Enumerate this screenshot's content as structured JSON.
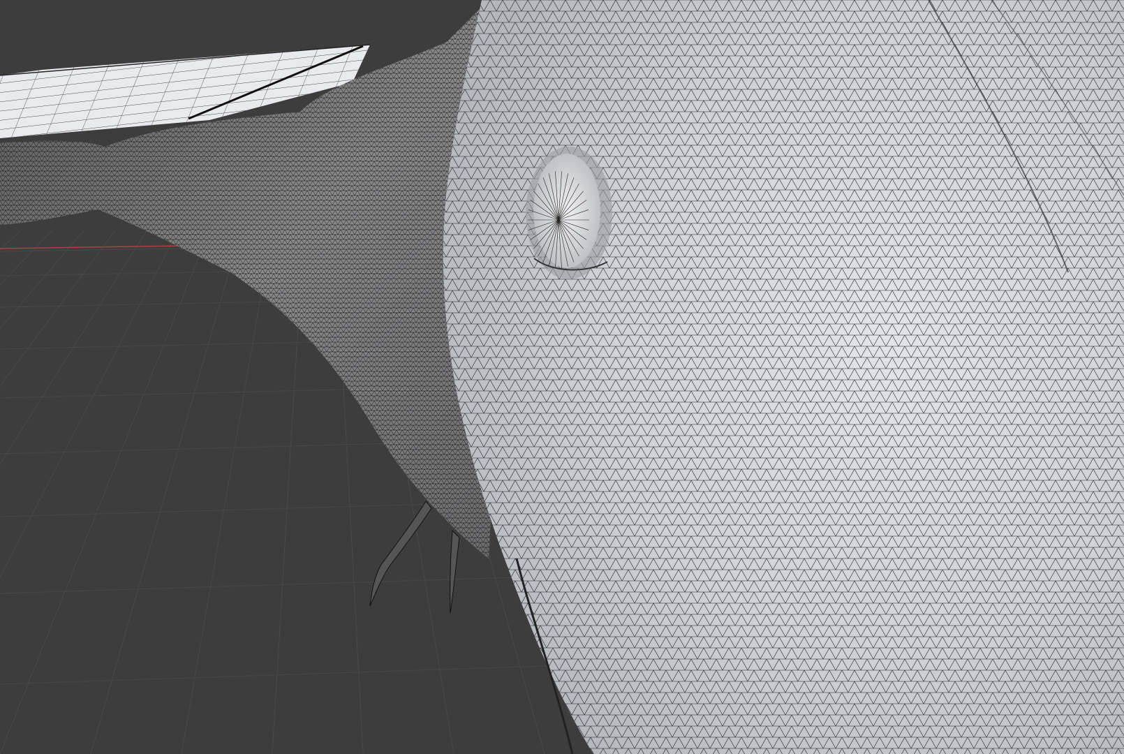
{
  "viewport": {
    "mode": "3d-viewport",
    "shading": "wireframe-overlay-on-solid",
    "background_color": "#3d3d3d",
    "grid_color": "#4a4a4a",
    "x_axis_color": "#b04040",
    "mesh_light_color": "#d8dbe2",
    "mesh_dark_color": "#2a2a2a",
    "wire_color": "#1a1a1a"
  },
  "objects": [
    {
      "name": "body-mesh",
      "icon": "mesh-icon"
    },
    {
      "name": "wing-mesh",
      "icon": "mesh-icon"
    },
    {
      "name": "eye-mesh",
      "icon": "mesh-icon"
    },
    {
      "name": "claw-mesh",
      "icon": "mesh-icon"
    }
  ]
}
